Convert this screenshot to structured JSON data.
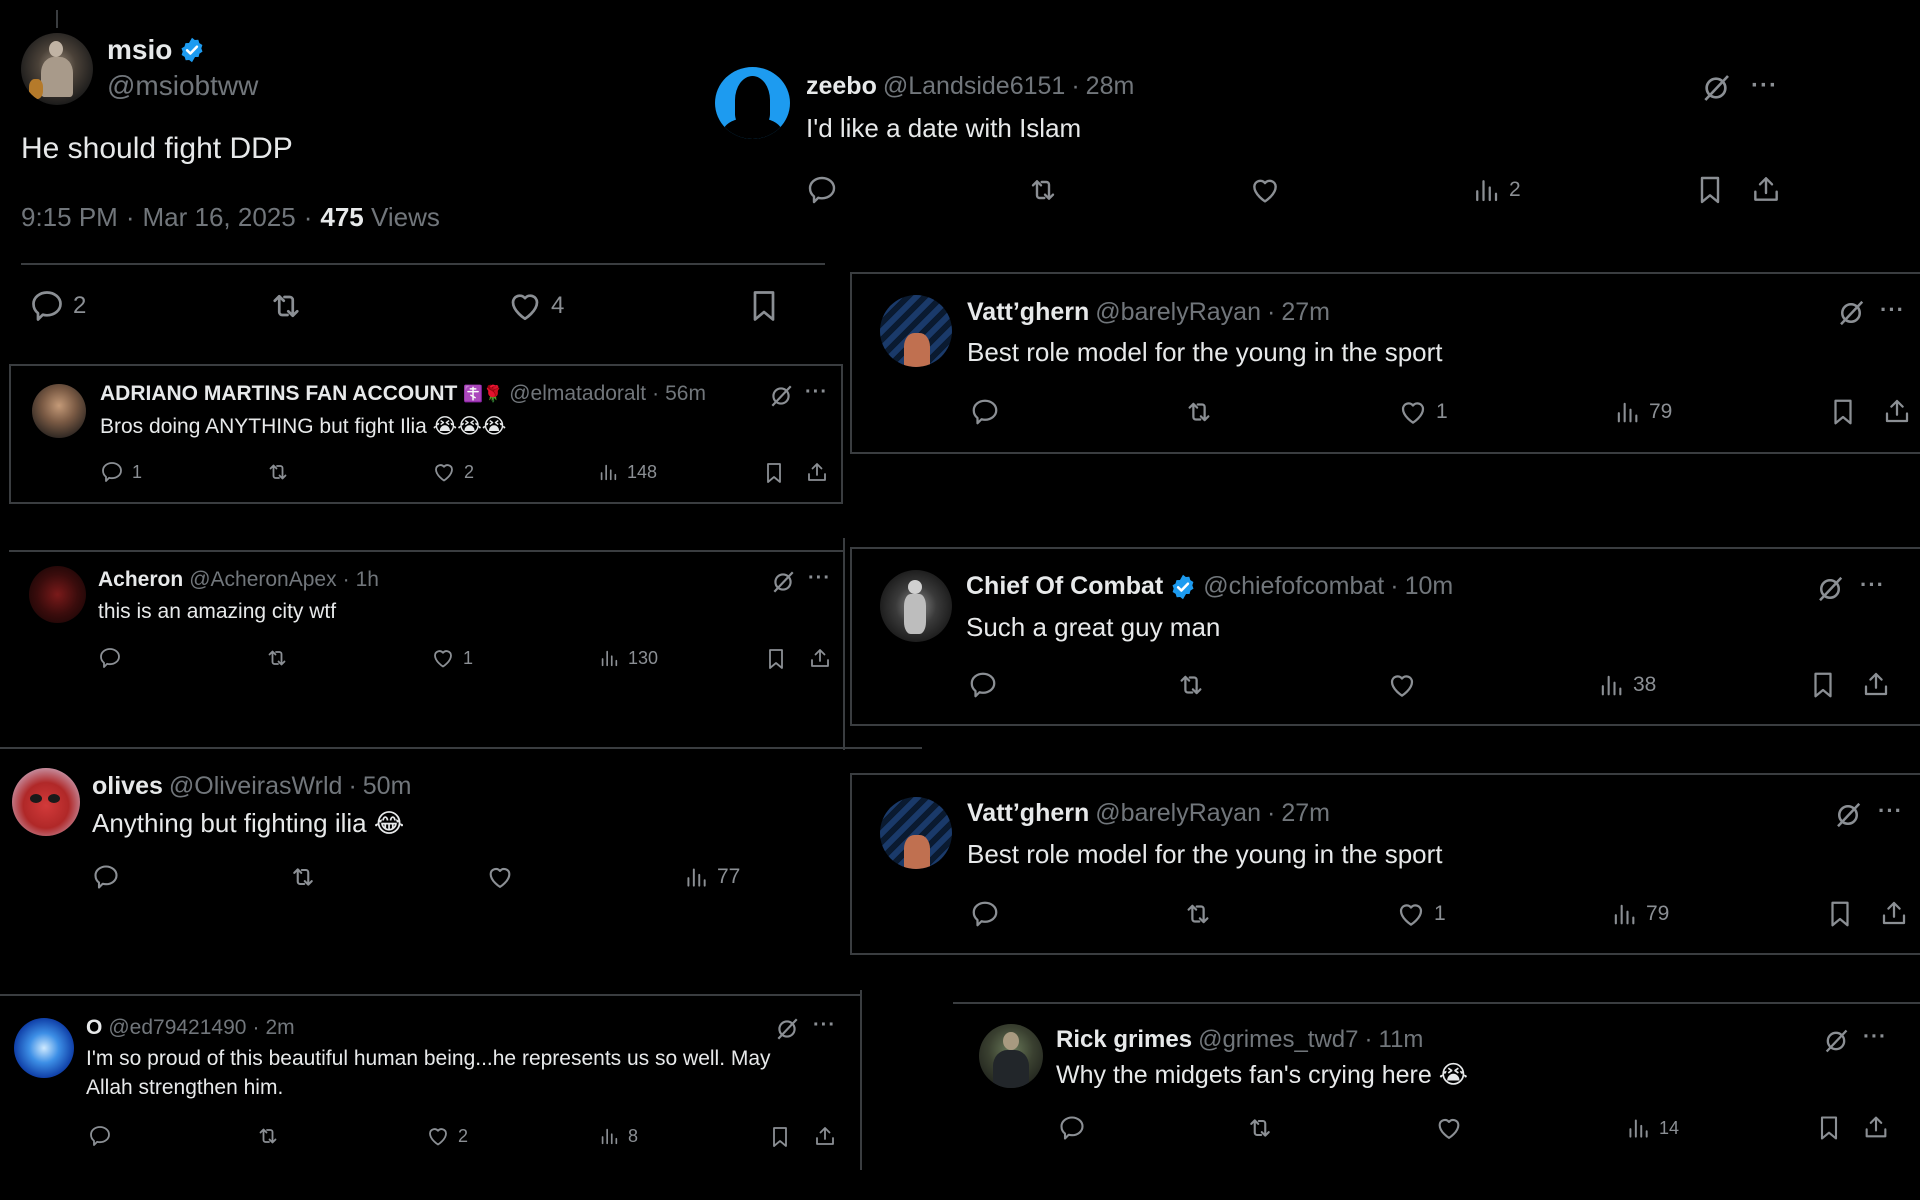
{
  "main_tweet": {
    "display_name": "msio",
    "verified": true,
    "handle": "@msiobtww",
    "text": "He should fight DDP",
    "time": "9:15 PM",
    "date": "Mar 16, 2025",
    "views_count": "475",
    "views_label": "Views",
    "separator": "·",
    "actions": {
      "replies": "2",
      "reposts": "",
      "likes": "4"
    },
    "avatar_colors": [
      "#2a2a2a",
      "#9a8b7a"
    ]
  },
  "colors": {
    "verified_blue": "#1d9bf0",
    "secondary_text": "#71767b",
    "primary_text": "#e7e9ea",
    "divider": "#3a3d40",
    "background": "#000000"
  },
  "replies": [
    {
      "id": "adriano",
      "display_name": "ADRIANO MARTINS FAN ACCOUNT",
      "name_emojis": "☦️🌹",
      "handle": "@elmatadoralt",
      "time": "56m",
      "text": "Bros doing ANYTHING but fight Ilia",
      "text_emojis": "😭😭😭",
      "replies": "1",
      "reposts": "",
      "likes": "2",
      "views": "148"
    },
    {
      "id": "acheron",
      "display_name": "Acheron",
      "handle": "@AcheronApex",
      "time": "1h",
      "text": "this is an amazing city wtf",
      "replies": "",
      "reposts": "",
      "likes": "1",
      "views": "130"
    },
    {
      "id": "olives",
      "display_name": "olives",
      "handle": "@OliveirasWrld",
      "time": "50m",
      "text": "Anything but fighting ilia",
      "text_emojis": "😂",
      "replies": "",
      "reposts": "",
      "likes": "",
      "views": "77"
    },
    {
      "id": "o",
      "display_name": "O",
      "handle": "@ed79421490",
      "time": "2m",
      "text_line1": "I'm so proud of this beautiful human being...he represents us so well. May",
      "text_line2": "Allah strengthen him.",
      "replies": "",
      "reposts": "",
      "likes": "2",
      "views": "8"
    },
    {
      "id": "zeebo",
      "display_name": "zeebo",
      "handle": "@Landside6151",
      "time": "28m",
      "text": "I'd like a date with Islam",
      "replies": "",
      "reposts": "",
      "likes": "",
      "views": "2"
    },
    {
      "id": "vatt1",
      "display_name": "Vatt’ghern",
      "handle": "@barelyRayan",
      "time": "27m",
      "text": "Best role model for the young in the sport",
      "replies": "",
      "reposts": "",
      "likes": "1",
      "views": "79"
    },
    {
      "id": "chief",
      "display_name": "Chief Of Combat",
      "verified": true,
      "handle": "@chiefofcombat",
      "time": "10m",
      "text": "Such a great guy man",
      "replies": "",
      "reposts": "",
      "likes": "",
      "views": "38"
    },
    {
      "id": "vatt2",
      "display_name": "Vatt’ghern",
      "handle": "@barelyRayan",
      "time": "27m",
      "text": "Best role model for the young in the sport",
      "replies": "",
      "reposts": "",
      "likes": "1",
      "views": "79"
    },
    {
      "id": "rick",
      "display_name": "Rick grimes",
      "handle": "@grimes_twd7",
      "time": "11m",
      "text": "Why the midgets fan's crying here",
      "text_emojis": "😭",
      "replies": "",
      "reposts": "",
      "likes": "",
      "views": "14"
    }
  ],
  "ui": {
    "separator": "·",
    "more_label": "···"
  }
}
